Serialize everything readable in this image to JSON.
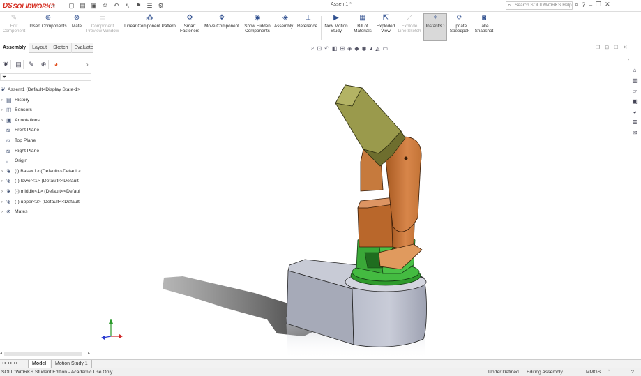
{
  "app": {
    "logo_prefix": "DS",
    "logo_text": "SOLIDWORKS",
    "doc_title": "Assem1 *",
    "search_placeholder": "Search SOLIDWORKS Help"
  },
  "quick_access": [
    "new-icon",
    "open-icon",
    "save-icon",
    "print-icon",
    "undo-icon",
    "select-icon",
    "rebuild-icon",
    "file-properties-icon",
    "options-icon"
  ],
  "commands": {
    "edit_component": [
      "Edit",
      "Component"
    ],
    "insert_components": "Insert Components",
    "mate": "Mate",
    "component_preview": [
      "Component",
      "Preview Window"
    ],
    "linear_pattern": "Linear Component Pattern",
    "smart_fasteners": [
      "Smart",
      "Fasteners"
    ],
    "move_component": "Move Component",
    "show_hidden": [
      "Show Hidden",
      "Components"
    ],
    "assembly_features": "Assembly...",
    "reference_geometry": "Reference...",
    "new_motion_study": [
      "New Motion",
      "Study"
    ],
    "bill_of_materials": [
      "Bill of",
      "Materials"
    ],
    "exploded_view": [
      "Exploded",
      "View"
    ],
    "explode_line_sketch": [
      "Explode",
      "Line Sketch"
    ],
    "instant3d": "Instant3D",
    "update_speedpak": [
      "Update",
      "Speedpak"
    ],
    "take_snapshot": [
      "Take",
      "Snapshot"
    ]
  },
  "tabs": [
    "Assembly",
    "Layout",
    "Sketch",
    "Evaluate"
  ],
  "tree": [
    {
      "label": "Assem1  (Default<Display State-1>",
      "level": 0,
      "icon": "assembly-icon"
    },
    {
      "label": "History",
      "level": 1,
      "icon": "history-icon"
    },
    {
      "label": "Sensors",
      "level": 1,
      "icon": "sensors-icon"
    },
    {
      "label": "Annotations",
      "level": 1,
      "icon": "annotations-icon"
    },
    {
      "label": "Front Plane",
      "level": 1,
      "icon": "plane-icon"
    },
    {
      "label": "Top Plane",
      "level": 1,
      "icon": "plane-icon"
    },
    {
      "label": "Right Plane",
      "level": 1,
      "icon": "plane-icon"
    },
    {
      "label": "Origin",
      "level": 1,
      "icon": "origin-icon"
    },
    {
      "label": "(f) Base<1> (Default<<Default>",
      "level": 1,
      "icon": "part-icon"
    },
    {
      "label": "(-) lower<1> (Default<<Default",
      "level": 1,
      "icon": "part-icon"
    },
    {
      "label": "(-) middle<1> (Default<<Defaul",
      "level": 1,
      "icon": "part-icon"
    },
    {
      "label": "(-) upper<2> (Default<<Default",
      "level": 1,
      "icon": "part-icon"
    },
    {
      "label": "Mates",
      "level": 1,
      "icon": "mates-icon"
    }
  ],
  "bottom_tabs": [
    "Model",
    "Motion Study 1"
  ],
  "status": {
    "edition": "SOLIDWORKS Student Edition - Academic Use Only",
    "definition": "Under Defined",
    "mode": "Editing Assembly",
    "units": "MMGS"
  },
  "colors": {
    "accent": "#2d6cc4",
    "logo_red": "#d52b1e",
    "base_gray": "#a6aab8",
    "lower_green": "#3db33b",
    "middle_orange": "#d07a35",
    "upper_olive": "#9a9a4c"
  }
}
